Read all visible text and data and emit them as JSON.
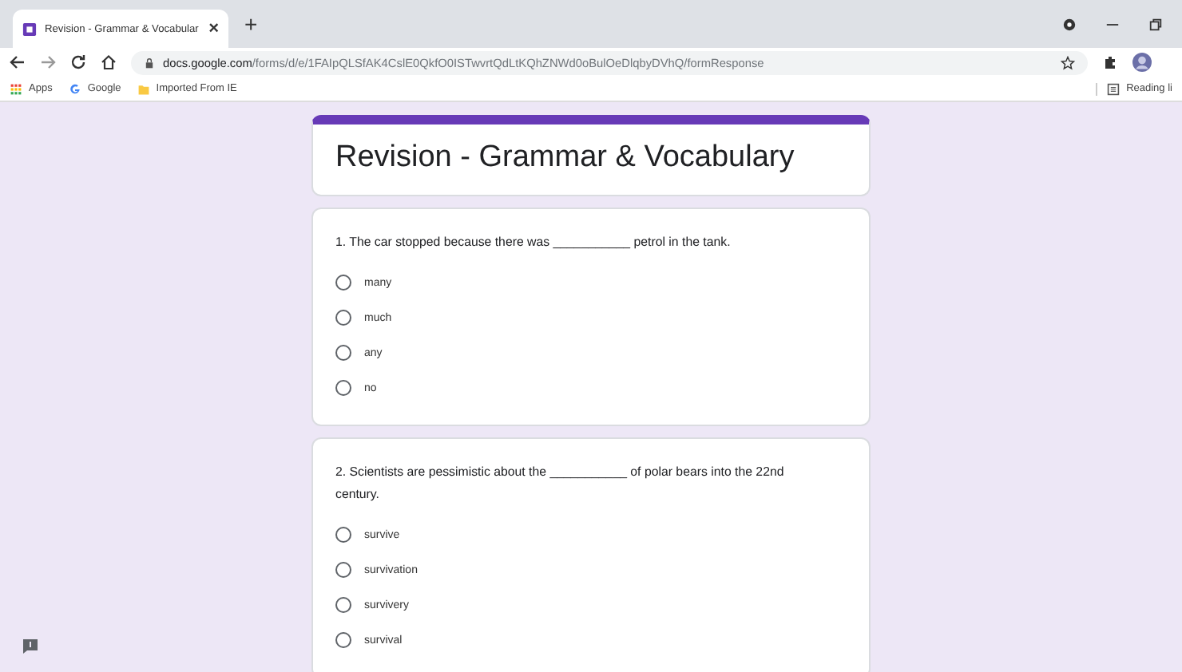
{
  "browser": {
    "tab": {
      "title": "Revision - Grammar & Vocabular",
      "close": "×"
    },
    "new_tab": "+",
    "url_host": "docs.google.com",
    "url_path": "/forms/d/e/1FAIpQLSfAK4CslE0QkfO0ISTwvrtQdLtKQhZNWd0oBulOeDlqbyDVhQ/formResponse",
    "bookmarks": [
      "Apps",
      "Google",
      "Imported From IE"
    ],
    "reading_list": "Reading li"
  },
  "form": {
    "title": "Revision - Grammar & Vocabulary",
    "questions": [
      {
        "text": "1. The car stopped because there was ___________ petrol in the tank.",
        "options": [
          {
            "label": "many",
            "selected": false
          },
          {
            "label": "much",
            "selected": false
          },
          {
            "label": "any",
            "selected": false
          },
          {
            "label": "no",
            "selected": false
          }
        ]
      },
      {
        "text": "2. Scientists are pessimistic about the ___________ of polar bears into the 22nd century.",
        "options": [
          {
            "label": "survive",
            "selected": false
          },
          {
            "label": "survivation",
            "selected": false
          },
          {
            "label": "survivery",
            "selected": false
          },
          {
            "label": "survival",
            "selected": false
          }
        ]
      }
    ]
  }
}
